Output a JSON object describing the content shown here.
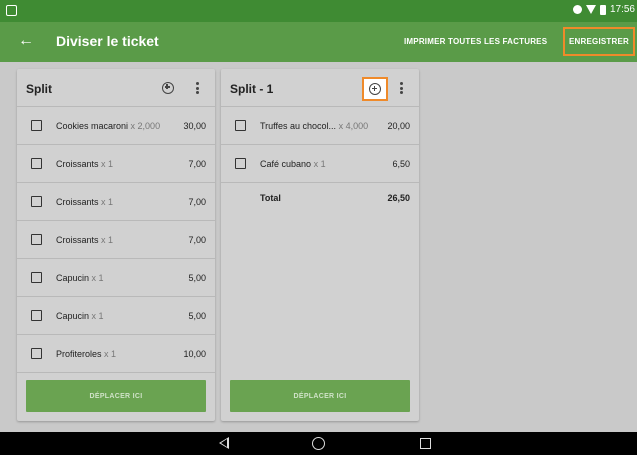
{
  "status_bar": {
    "time": "17:56"
  },
  "appbar": {
    "title": "Diviser le ticket",
    "print_all_label": "IMPRIMER TOUTES LES FACTURES",
    "save_label": "ENREGISTRER"
  },
  "split_main": {
    "title": "Split",
    "items": [
      {
        "name": "Cookies macaroni",
        "qty": "x 2,000",
        "price": "30,00"
      },
      {
        "name": "Croissants",
        "qty": "x 1",
        "price": "7,00"
      },
      {
        "name": "Croissants",
        "qty": "x 1",
        "price": "7,00"
      },
      {
        "name": "Croissants",
        "qty": "x 1",
        "price": "7,00"
      },
      {
        "name": "Capucin",
        "qty": "x 1",
        "price": "5,00"
      },
      {
        "name": "Capucin",
        "qty": "x 1",
        "price": "5,00"
      },
      {
        "name": "Profiteroles",
        "qty": "x 1",
        "price": "10,00"
      }
    ],
    "move_label": "DÉPLACER ICI"
  },
  "split_1": {
    "title": "Split - 1",
    "items": [
      {
        "name": "Truffes au chocol...",
        "qty": "x 4,000",
        "price": "20,00"
      },
      {
        "name": "Café cubano",
        "qty": "x 1",
        "price": "6,50"
      }
    ],
    "total_label": "Total",
    "total_value": "26,50",
    "move_label": "DÉPLACER ICI"
  },
  "colors": {
    "status_bar": "#3f8b33",
    "app_bar": "#5a9b48",
    "highlight": "#ef8a2a",
    "move_button": "#6aa351"
  }
}
